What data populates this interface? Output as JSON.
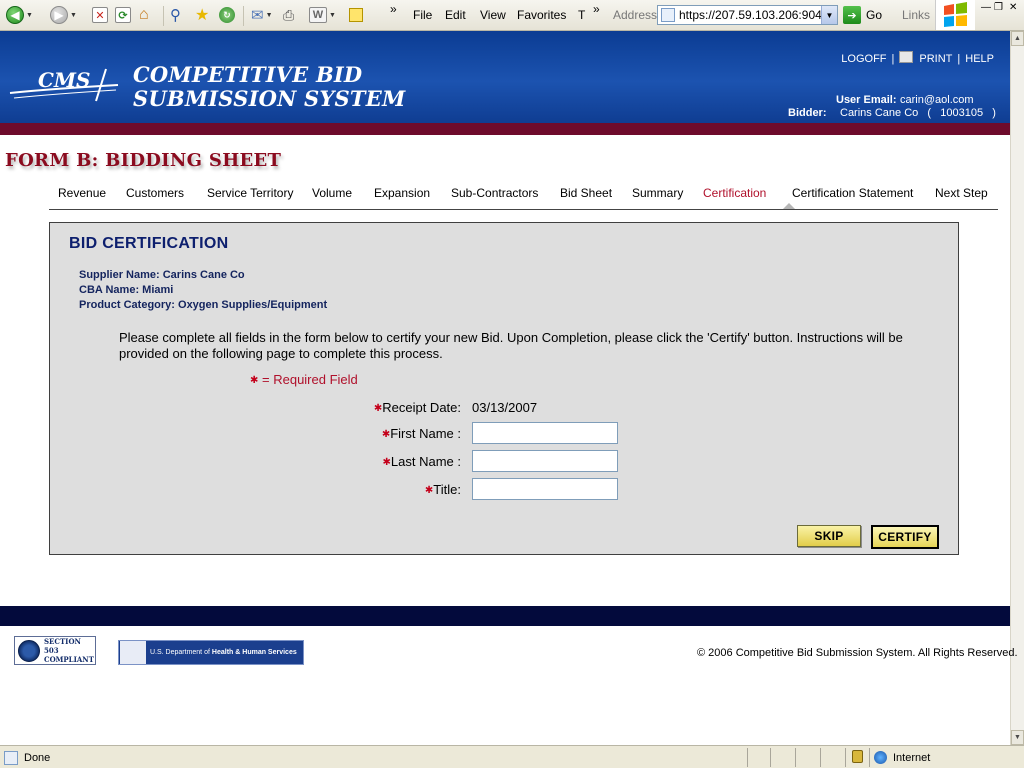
{
  "browser": {
    "menu": [
      "File",
      "Edit",
      "View",
      "Favorites",
      "T"
    ],
    "address_label": "Address",
    "address_url": "https://207.59.103.206:904",
    "go_label": "Go",
    "links_label": "Links",
    "status_text": "Done",
    "zone_text": "Internet"
  },
  "header": {
    "logo_text": "CMS",
    "title_line1": "COMPETITIVE BID",
    "title_line2": "SUBMISSION SYSTEM",
    "logoff": "LOGOFF",
    "print": "PRINT",
    "help": "HELP",
    "separator": "|",
    "user_email_label": "User Email:",
    "user_email": "carin@aol.com",
    "bidder_label": "Bidder:",
    "bidder_value": "Carins Cane Co   (   1003105   )"
  },
  "form_title": "FORM B:  BIDDING SHEET",
  "tabs": [
    {
      "label": "Revenue"
    },
    {
      "label": "Customers"
    },
    {
      "label": "Service Territory"
    },
    {
      "label": "Volume"
    },
    {
      "label": "Expansion"
    },
    {
      "label": "Sub-Contractors"
    },
    {
      "label": "Bid Sheet"
    },
    {
      "label": "Summary"
    },
    {
      "label": "Certification"
    },
    {
      "label": "Certification Statement"
    },
    {
      "label": "Next Step"
    }
  ],
  "active_tab": "Certification",
  "panel": {
    "title": "BID CERTIFICATION",
    "supplier_name": "Supplier Name: Carins Cane Co",
    "cba_name": "CBA Name: Miami",
    "product_category": "Product Category: Oxygen Supplies/Equipment",
    "instructions": "Please complete all fields in the form below to certify your new Bid. Upon Completion, please click the 'Certify' button. Instructions will be provided on the following page to complete this process.",
    "required_note": "= Required Field",
    "receipt_date_label": "Receipt Date:",
    "receipt_date_value": "03/13/2007",
    "first_name_label": "First Name :",
    "first_name_value": "",
    "last_name_label": "Last Name :",
    "last_name_value": "",
    "title_label": "Title:",
    "title_value": "",
    "skip_label": "SKIP",
    "certify_label": "CERTIFY"
  },
  "footer": {
    "section508_line1": "SECTION 503",
    "section508_line2": "COMPLIANT",
    "hhs_text_light": "U.S. Department of",
    "hhs_text_bold": "Health & Human Services",
    "copyright": "© 2006 Competitive Bid Submission System. All Rights Reserved."
  },
  "colors": {
    "header_blue": "#1c53b0",
    "stripe_maroon": "#6e0b2c",
    "active_tab_red": "#b0102b",
    "panel_gray": "#dedede",
    "footer_navy": "#030a3c"
  }
}
